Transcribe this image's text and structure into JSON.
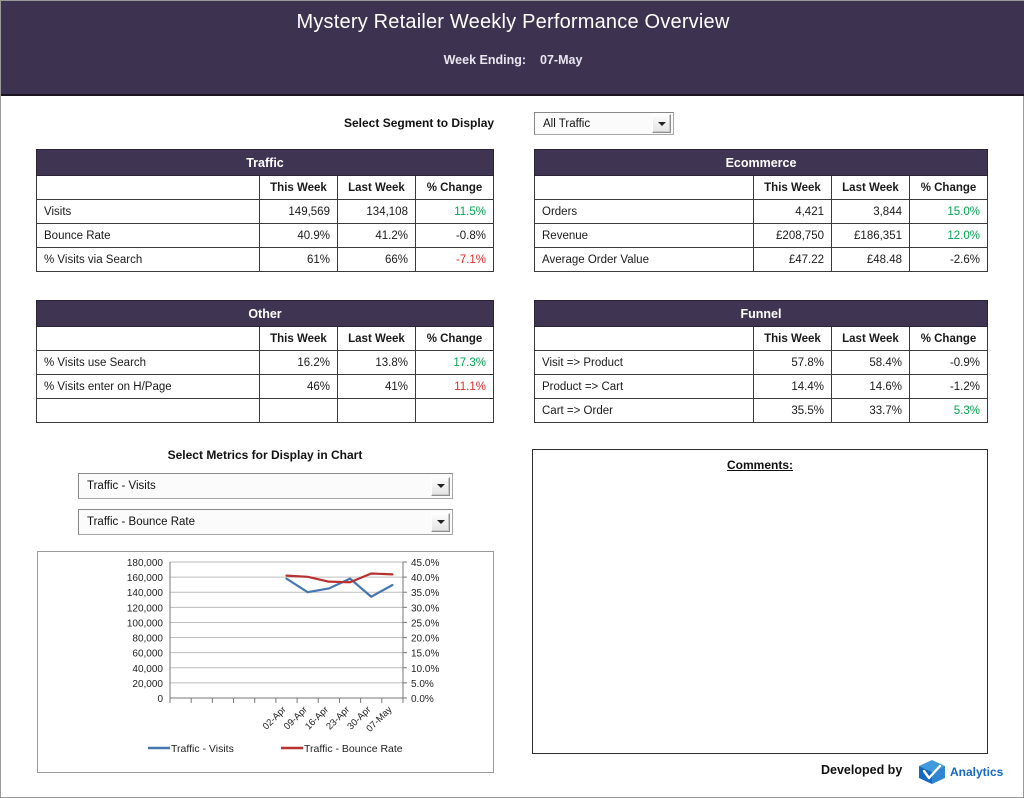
{
  "header": {
    "title": "Mystery Retailer Weekly Performance Overview",
    "week_ending_label": "Week Ending:",
    "week_ending_value": "07-May",
    "bg_color": "#3d3351"
  },
  "segment": {
    "label": "Select Segment to Display",
    "selected": "All Traffic",
    "options": [
      "All Traffic"
    ]
  },
  "columns": [
    "",
    "This Week",
    "Last Week",
    "% Change"
  ],
  "tables": [
    {
      "id": "traffic",
      "title": "Traffic",
      "rows": [
        {
          "label": "Visits",
          "this_week": "149,569",
          "last_week": "134,108",
          "change": "11.5%",
          "dir": "up"
        },
        {
          "label": "Bounce Rate",
          "this_week": "40.9%",
          "last_week": "41.2%",
          "change": "-0.8%",
          "dir": "flat"
        },
        {
          "label": "% Visits via Search",
          "this_week": "61%",
          "last_week": "66%",
          "change": "-7.1%",
          "dir": "down"
        }
      ]
    },
    {
      "id": "ecommerce",
      "title": "Ecommerce",
      "rows": [
        {
          "label": "Orders",
          "this_week": "4,421",
          "last_week": "3,844",
          "change": "15.0%",
          "dir": "up"
        },
        {
          "label": "Revenue",
          "this_week": "£208,750",
          "last_week": "£186,351",
          "change": "12.0%",
          "dir": "up"
        },
        {
          "label": "Average Order Value",
          "this_week": "£47.22",
          "last_week": "£48.48",
          "change": "-2.6%",
          "dir": "flat"
        }
      ]
    },
    {
      "id": "other",
      "title": "Other",
      "rows": [
        {
          "label": "% Visits use Search",
          "this_week": "16.2%",
          "last_week": "13.8%",
          "change": "17.3%",
          "dir": "up"
        },
        {
          "label": "% Visits enter on H/Page",
          "this_week": "46%",
          "last_week": "41%",
          "change": "11.1%",
          "dir": "down"
        },
        {
          "label": "",
          "this_week": "",
          "last_week": "",
          "change": "",
          "dir": "flat"
        }
      ]
    },
    {
      "id": "funnel",
      "title": "Funnel",
      "rows": [
        {
          "label": "Visit => Product",
          "this_week": "57.8%",
          "last_week": "58.4%",
          "change": "-0.9%",
          "dir": "flat"
        },
        {
          "label": "Product => Cart",
          "this_week": "14.4%",
          "last_week": "14.6%",
          "change": "-1.2%",
          "dir": "flat"
        },
        {
          "label": "Cart => Order",
          "this_week": "35.5%",
          "last_week": "33.7%",
          "change": "5.3%",
          "dir": "up"
        }
      ]
    }
  ],
  "metrics": {
    "label": "Select Metrics for Display in Chart",
    "metric1": "Traffic - Visits",
    "metric2": "Traffic - Bounce Rate"
  },
  "comments": {
    "title": "Comments:",
    "body": ""
  },
  "footer": {
    "credit": "Developed by",
    "logo_word": "Analytics",
    "logo_color": "#1268c3"
  },
  "chart_data": {
    "type": "line",
    "title": "",
    "xlabel": "",
    "grid": true,
    "legend_position": "bottom",
    "x": [
      "02-Apr",
      "09-Apr",
      "16-Apr",
      "23-Apr",
      "30-Apr",
      "07-May"
    ],
    "xtick_rotation": -45,
    "x_slots": 11,
    "axes": [
      {
        "id": "left",
        "label": "",
        "ylim": [
          0,
          180000
        ],
        "ticks": [
          0,
          20000,
          40000,
          60000,
          80000,
          100000,
          120000,
          140000,
          160000,
          180000
        ],
        "ticklabels": [
          "0",
          "20,000",
          "40,000",
          "60,000",
          "80,000",
          "100,000",
          "120,000",
          "140,000",
          "160,000",
          "180,000"
        ]
      },
      {
        "id": "right",
        "label": "",
        "ylim": [
          0,
          45
        ],
        "ticks": [
          0,
          5,
          10,
          15,
          20,
          25,
          30,
          35,
          40,
          45
        ],
        "ticklabels": [
          "0.0%",
          "5.0%",
          "10.0%",
          "15.0%",
          "20.0%",
          "25.0%",
          "30.0%",
          "35.0%",
          "40.0%",
          "45.0%"
        ]
      }
    ],
    "series": [
      {
        "name": "Traffic - Visits",
        "axis": "left",
        "color": "#4677b5",
        "values": [
          158000,
          140000,
          145000,
          158000,
          134000,
          149569
        ]
      },
      {
        "name": "Traffic - Bounce Rate",
        "axis": "right",
        "color": "#b8312f",
        "values": [
          40.5,
          40.1,
          38.5,
          38.3,
          41.2,
          40.9
        ]
      }
    ]
  }
}
